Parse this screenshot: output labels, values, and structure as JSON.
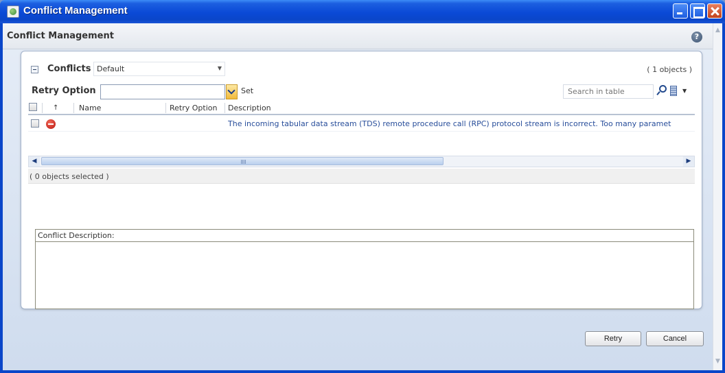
{
  "window": {
    "title": "Conflict Management"
  },
  "header": {
    "title": "Conflict Management",
    "help_glyph": "?"
  },
  "conflicts_panel": {
    "label": "Conflicts",
    "view_selected": "Default",
    "object_count": "( 1 objects )",
    "retry_option_label": "Retry Option",
    "retry_option_value": "",
    "set_label": "Set",
    "search_placeholder": "Search in table",
    "columns": [
      "Name",
      "Retry Option",
      "Description"
    ],
    "rows": [
      {
        "name": "",
        "retry_option": "",
        "description": "The incoming tabular data stream (TDS) remote procedure call (RPC) protocol stream is incorrect. Too many paramet",
        "status_icon": "error-icon"
      }
    ],
    "selection_status": "( 0 objects selected )",
    "conflict_description_label": "Conflict Description:"
  },
  "buttons": {
    "retry": "Retry",
    "cancel": "Cancel"
  },
  "colors": {
    "titlebar": "#0a49d6",
    "link_text": "#274d9a",
    "error": "#c41a12"
  }
}
